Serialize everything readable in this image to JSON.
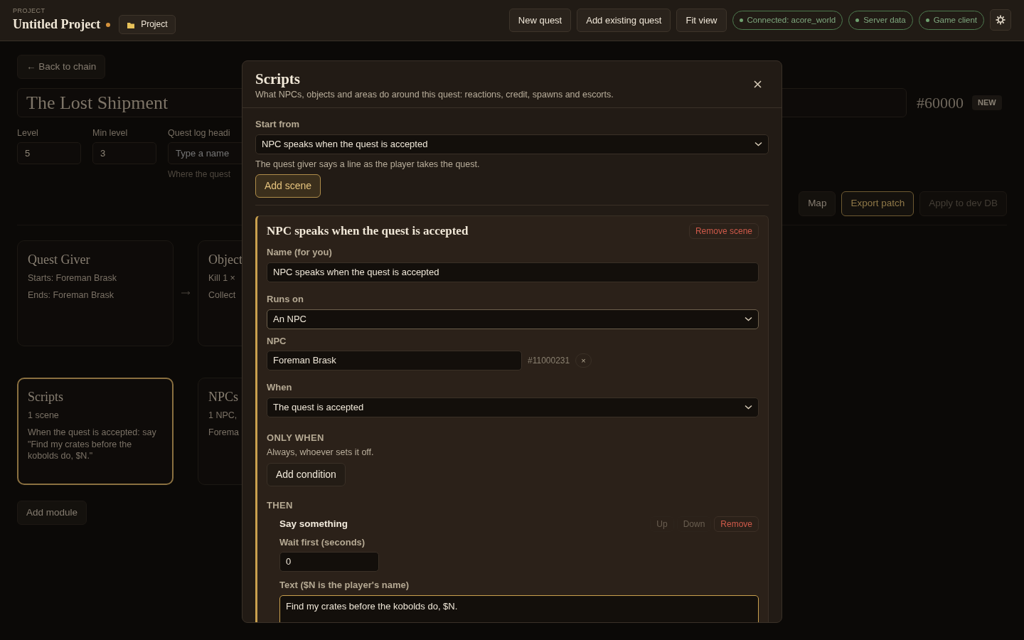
{
  "header": {
    "eyebrow": "PROJECT",
    "title": "Untitled Project",
    "unsaved": true,
    "project_button": "Project",
    "actions": [
      "New quest",
      "Add existing quest",
      "Fit view"
    ],
    "statuses": [
      {
        "label": "Connected: acore_world",
        "color": "#6fa06f"
      },
      {
        "label": "Server data",
        "color": "#6fa06f"
      },
      {
        "label": "Game client",
        "color": "#6fa06f"
      }
    ]
  },
  "quest": {
    "back": "← Back to chain",
    "title": "The Lost Shipment",
    "id": "#60000",
    "badge": "NEW",
    "fields": [
      {
        "label": "Level",
        "value": "5"
      },
      {
        "label": "Min level",
        "value": "3"
      },
      {
        "label": "Quest log headi",
        "placeholder": "Type a name",
        "hint": "Where the quest"
      }
    ],
    "toolbar": [
      {
        "label": "Map",
        "kind": "plain",
        "disabled": false
      },
      {
        "label": "Export patch",
        "kind": "accent",
        "disabled": false
      },
      {
        "label": "Apply to dev DB",
        "kind": "plain",
        "disabled": true
      }
    ],
    "module_rows": [
      [
        {
          "title": "Quest Giver",
          "lines": [
            "Starts: Foreman Brask",
            "Ends: Foreman Brask"
          ],
          "selected": false
        },
        {
          "title": "Object",
          "lines": [
            "Kill 1 ×",
            "Collect"
          ],
          "selected": false
        }
      ],
      [
        {
          "title": "Scripts",
          "lines": [
            "1 scene",
            "When the quest is accepted: say \"Find my crates before the kobolds do, $N.\""
          ],
          "selected": true
        },
        {
          "title": "NPCs",
          "lines": [
            "1 NPC,",
            "Forema"
          ],
          "selected": false
        }
      ]
    ],
    "add_module": "Add module"
  },
  "modal": {
    "title": "Scripts",
    "subtitle": "What NPCs, objects and areas do around this quest: reactions, credit, spawns and escorts.",
    "start_from": {
      "label": "Start from",
      "value": "NPC speaks when the quest is accepted",
      "help": "The quest giver says a line as the player takes the quest."
    },
    "add_scene": "Add scene",
    "scene": {
      "title": "NPC speaks when the quest is accepted",
      "remove": "Remove scene",
      "name_label": "Name (for you)",
      "name_value": "NPC speaks when the quest is accepted",
      "runs_on_label": "Runs on",
      "runs_on_value": "An NPC",
      "npc_label": "NPC",
      "npc_value": "Foreman Brask",
      "npc_id": "#11000231",
      "npc_clear": "×",
      "when_label": "When",
      "when_value": "The quest is accepted",
      "only_when_heading": "ONLY WHEN",
      "only_when_text": "Always, whoever sets it off.",
      "add_condition": "Add condition",
      "then_heading": "THEN",
      "actions": [
        {
          "title": "Say something",
          "buttons": [
            {
              "label": "Up",
              "kind": "plain",
              "disabled": true
            },
            {
              "label": "Down",
              "kind": "plain",
              "disabled": true
            },
            {
              "label": "Remove",
              "kind": "danger",
              "disabled": false
            }
          ],
          "wait_label": "Wait first (seconds)",
          "wait_value": "0",
          "text_label": "Text ($N is the player's name)",
          "text_value": "Find my crates before the kobolds do, $N.",
          "focused": true
        }
      ]
    }
  }
}
